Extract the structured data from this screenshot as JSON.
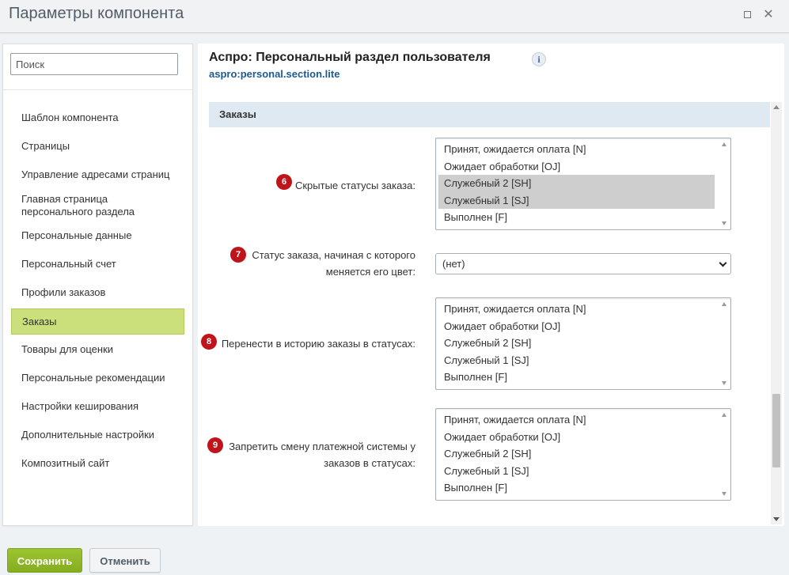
{
  "window": {
    "title": "Параметры компонента"
  },
  "sidebar": {
    "search_placeholder": "Поиск",
    "items": [
      {
        "label": "Шаблон компонента"
      },
      {
        "label": "Страницы"
      },
      {
        "label": "Управление адресами страниц"
      },
      {
        "label": "Главная страница персонального раздела"
      },
      {
        "label": "Персональные данные"
      },
      {
        "label": "Персональный счет"
      },
      {
        "label": "Профили заказов"
      },
      {
        "label": "Заказы",
        "active": true
      },
      {
        "label": "Товары для оценки"
      },
      {
        "label": "Персональные рекомендации"
      },
      {
        "label": "Настройки кеширования"
      },
      {
        "label": "Дополнительные настройки"
      },
      {
        "label": "Композитный сайт"
      }
    ]
  },
  "component": {
    "title": "Аспро: Персональный раздел пользователя",
    "code": "aspro:personal.section.lite",
    "info_icon": "i"
  },
  "section": {
    "title": "Заказы",
    "fields": [
      {
        "badge": "6",
        "label": "Скрытые статусы заказа:",
        "type": "multiselect",
        "options": [
          "Принят, ожидается оплата [N]",
          "Ожидает обработки [OJ]",
          "Служебный 2 [SH]",
          "Служебный 1 [SJ]",
          "Выполнен [F]"
        ],
        "selected": [
          false,
          false,
          true,
          true,
          false
        ]
      },
      {
        "badge": "7",
        "label_line1": "Статус заказа, начиная с которого",
        "label_line2": "меняется его цвет:",
        "type": "select",
        "value": "(нет)"
      },
      {
        "badge": "8",
        "label": "Перенести в историю заказы в статусах:",
        "type": "multiselect",
        "options": [
          "Принят, ожидается оплата [N]",
          "Ожидает обработки [OJ]",
          "Служебный 2 [SH]",
          "Служебный 1 [SJ]",
          "Выполнен [F]"
        ],
        "selected": [
          false,
          false,
          false,
          false,
          false
        ]
      },
      {
        "badge": "9",
        "label_line1": "Запретить смену платежной системы у",
        "label_line2": "заказов в статусах:",
        "type": "multiselect",
        "options": [
          "Принят, ожидается оплата [N]",
          "Ожидает обработки [OJ]",
          "Служебный 2 [SH]",
          "Служебный 1 [SJ]",
          "Выполнен [F]"
        ],
        "selected": [
          false,
          false,
          false,
          false,
          false
        ]
      }
    ]
  },
  "footer": {
    "save_label": "Сохранить",
    "cancel_label": "Отменить"
  },
  "colors": {
    "active_nav": "#cbe07b",
    "badge": "#c0141b",
    "save_button": "#8fb82a",
    "section_header": "#dfe9f2",
    "link": "#1d5a91"
  }
}
